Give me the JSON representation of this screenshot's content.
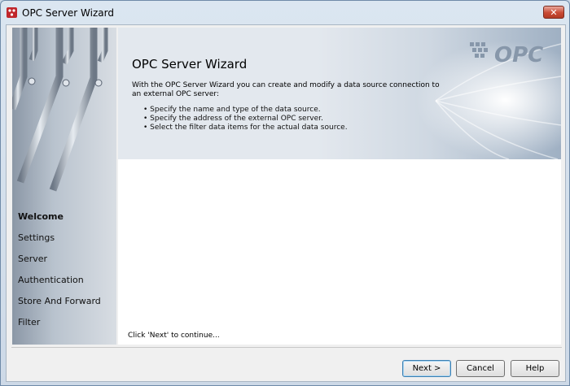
{
  "window": {
    "title": "OPC Server Wizard",
    "close_label": "✕"
  },
  "sidebar": {
    "steps": [
      {
        "label": "Welcome",
        "active": true
      },
      {
        "label": "Settings",
        "active": false
      },
      {
        "label": "Server",
        "active": false
      },
      {
        "label": "Authentication",
        "active": false
      },
      {
        "label": "Store And Forward",
        "active": false
      },
      {
        "label": "Filter",
        "active": false
      }
    ]
  },
  "banner": {
    "title": "OPC Server Wizard",
    "logo_text": "OPC",
    "description": "With the OPC Server Wizard you can create and modify a data source connection to an external OPC server:",
    "bullets": [
      "• Specify the name and type of the data source.",
      "• Specify the address of the external OPC server.",
      "• Select the filter data items for the actual data source."
    ]
  },
  "hint": "Click 'Next' to continue...",
  "buttons": {
    "next": "Next >",
    "cancel": "Cancel",
    "help": "Help"
  },
  "colors": {
    "close_button": "#c94a34",
    "default_button_border": "#3c7fb1",
    "banner_bg": "#e3e8ee"
  }
}
